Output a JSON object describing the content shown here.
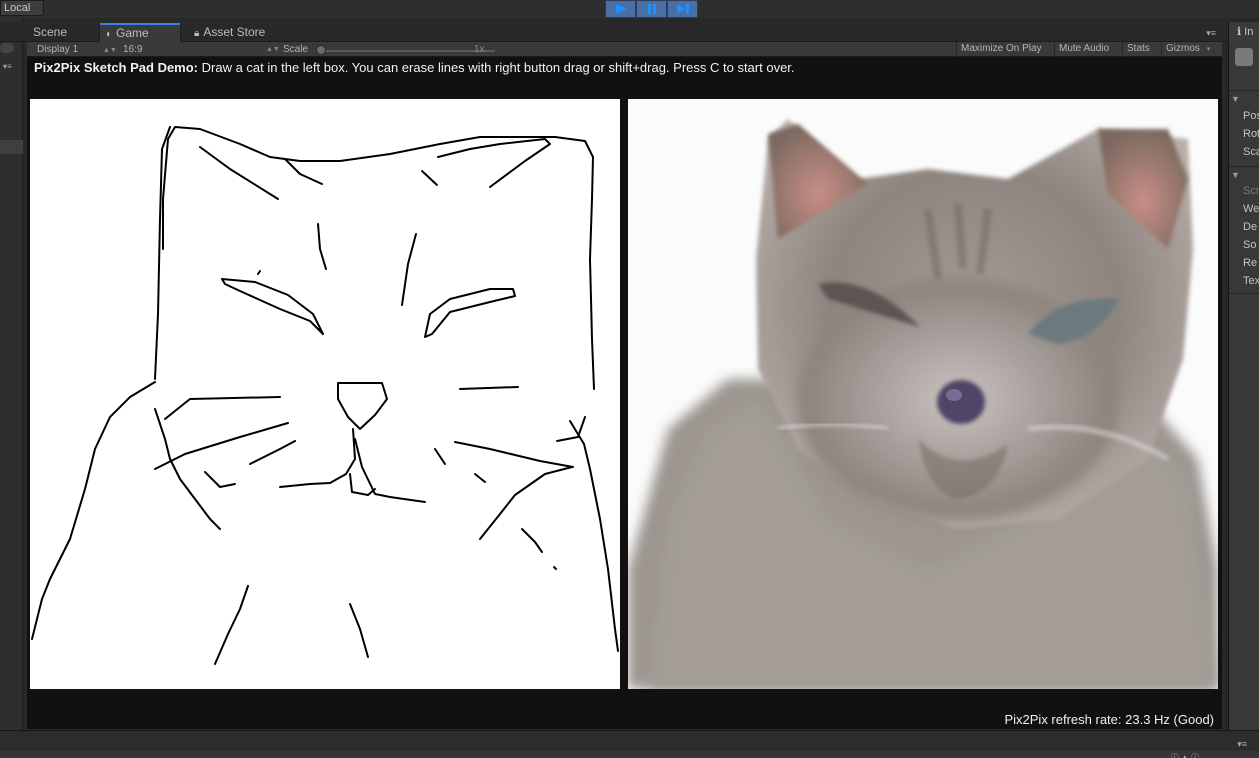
{
  "toolbar": {
    "local_label": "Local",
    "play_icon": "play-icon",
    "pause_icon": "pause-icon",
    "step_icon": "step-icon",
    "accent": "#4a6fa5"
  },
  "tabs": [
    {
      "label": "Scene",
      "icon": ""
    },
    {
      "label": "Game",
      "icon": "game-icon",
      "active": true
    },
    {
      "label": "Asset Store",
      "icon": "lock-icon"
    }
  ],
  "game_toolbar": {
    "display": "Display 1",
    "aspect": "16:9",
    "scale_label": "Scale",
    "scale_value": "1x",
    "maximize": "Maximize On Play",
    "mute": "Mute Audio",
    "stats": "Stats",
    "gizmos": "Gizmos"
  },
  "game": {
    "instruction_bold": "Pix2Pix Sketch Pad Demo:",
    "instruction_text": " Draw a cat in the left box. You can erase lines with right button drag or shift+drag. Press C to start over.",
    "refresh_rate": "Pix2Pix refresh rate: 23.3 Hz (Good)"
  },
  "inspector": {
    "tab_label": "In",
    "rows": [
      "Pos",
      "Rot",
      "Sca",
      "Scr",
      "We",
      "De",
      "So",
      "Re",
      "Tex"
    ]
  }
}
